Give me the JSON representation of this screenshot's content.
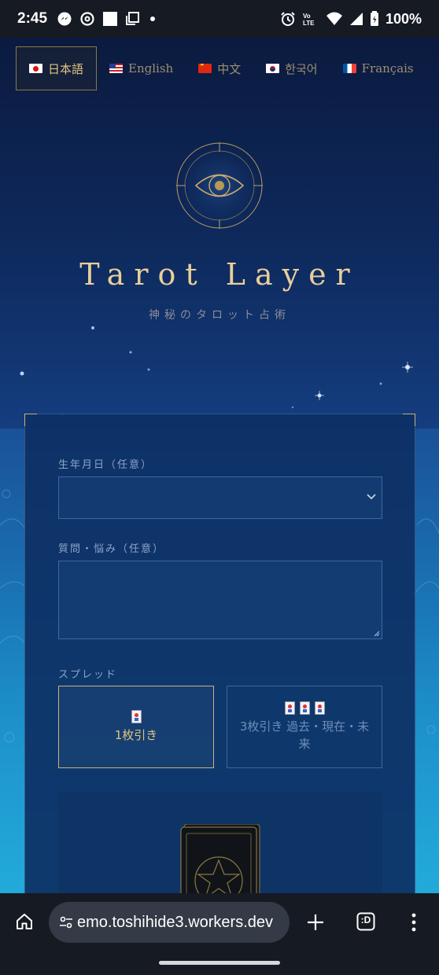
{
  "status_bar": {
    "time": "2:45",
    "battery": "100%",
    "icons_left": [
      "messenger-icon",
      "threads-icon",
      "square-icon",
      "copy-icon",
      "dot-icon"
    ],
    "icons_right": [
      "alarm-icon",
      "volte-icon",
      "wifi-icon",
      "signal-icon",
      "battery-icon"
    ]
  },
  "language_bar": {
    "items": [
      {
        "label": "日本語",
        "flag": "jp-flag-icon",
        "active": true
      },
      {
        "label": "English",
        "flag": "us-flag-icon",
        "active": false
      },
      {
        "label": "中文",
        "flag": "cn-flag-icon",
        "active": false
      },
      {
        "label": "한국어",
        "flag": "kr-flag-icon",
        "active": false
      },
      {
        "label": "Français",
        "flag": "fr-flag-icon",
        "active": false
      }
    ]
  },
  "hero": {
    "logo_icon": "eye-compass-icon",
    "title": "Tarot Layer",
    "subtitle": "神秘のタロット占術"
  },
  "form": {
    "birthdate_label": "生年月日（任意）",
    "birthdate_value": "",
    "question_label": "質問・悩み（任意）",
    "question_value": "",
    "spread_label": "スプレッド",
    "spread_options": [
      {
        "label": "1枚引き",
        "cards": 1,
        "selected": true
      },
      {
        "label": "3枚引き 過去・現在・未来",
        "cards": 3,
        "selected": false
      }
    ],
    "deck_icon": "tarot-deck-star-icon"
  },
  "browser": {
    "url": "emo.toshihide3.workers.dev",
    "tab_switcher_label": ":D"
  },
  "colors": {
    "gold": "#e0c47f",
    "gold_border": "#c9b27a",
    "night_top": "#0b1a3f",
    "ocean": "#26a9d8",
    "chrome_bar": "#161a22"
  }
}
